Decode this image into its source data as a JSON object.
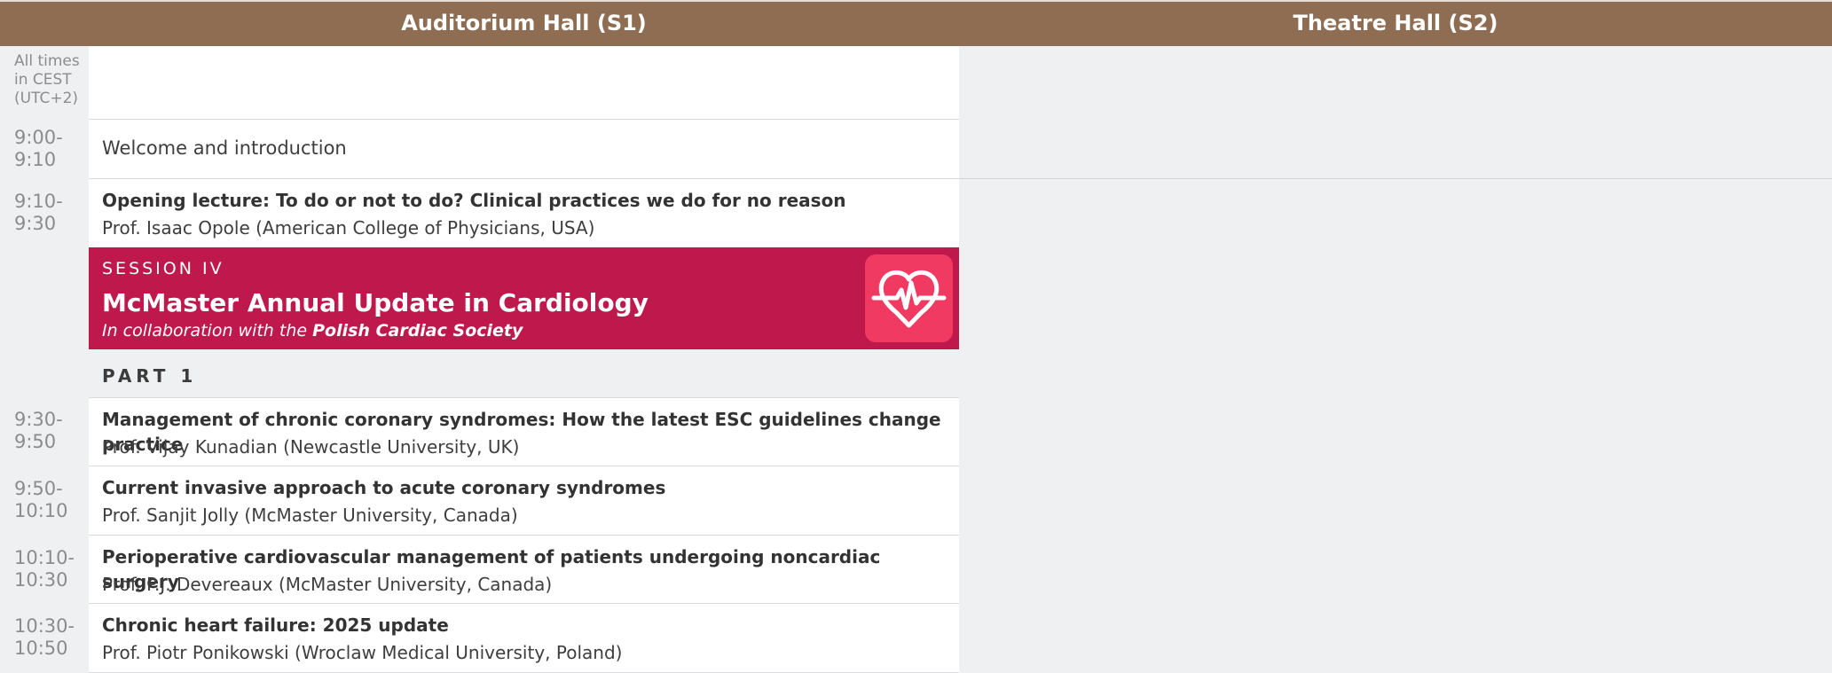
{
  "header": {
    "hall_s1": "Auditorium Hall (S1)",
    "hall_s2": "Theatre Hall (S2)"
  },
  "timezone_note": [
    "All times",
    "in CEST",
    "(UTC+2)"
  ],
  "rows_before": [
    {
      "time": [
        "9:00-",
        "9:10"
      ],
      "plain": "Welcome and introduction"
    },
    {
      "time": [
        "9:10-",
        "9:30"
      ],
      "title": "Opening lecture: To do or not to do? Clinical practices we do for no reason",
      "speaker": "Prof. Isaac Opole (American College of Physicians, USA)"
    }
  ],
  "session": {
    "label": "SESSION IV",
    "title": "McMaster Annual Update in Cardiology",
    "subtitle_prefix": "In collaboration with the ",
    "subtitle_org": "Polish Cardiac Society",
    "icon": "heart-pulse-icon",
    "color": "#bf184c",
    "icon_bg": "#f03a62"
  },
  "part_label": "PART 1",
  "rows": [
    {
      "time": [
        "9:30-",
        "9:50"
      ],
      "title": "Management of chronic coronary syndromes: How the latest ESC guidelines change practice",
      "speaker": "Prof. Vijay Kunadian (Newcastle University, UK)"
    },
    {
      "time": [
        "9:50-",
        "10:10"
      ],
      "title": "Current invasive approach to acute coronary syndromes",
      "speaker": "Prof. Sanjit Jolly (McMaster University, Canada)"
    },
    {
      "time": [
        "10:10-",
        "10:30"
      ],
      "title": "Perioperative cardiovascular management of patients undergoing noncardiac surgery",
      "speaker": "Prof. P.J. Devereaux (McMaster University, Canada)"
    },
    {
      "time": [
        "10:30-",
        "10:50"
      ],
      "title": "Chronic heart failure: 2025 update",
      "speaker": "Prof. Piotr Ponikowski (Wroclaw Medical University, Poland)"
    }
  ],
  "colors": {
    "header": "#8e6d52",
    "background": "#eff0f2"
  }
}
